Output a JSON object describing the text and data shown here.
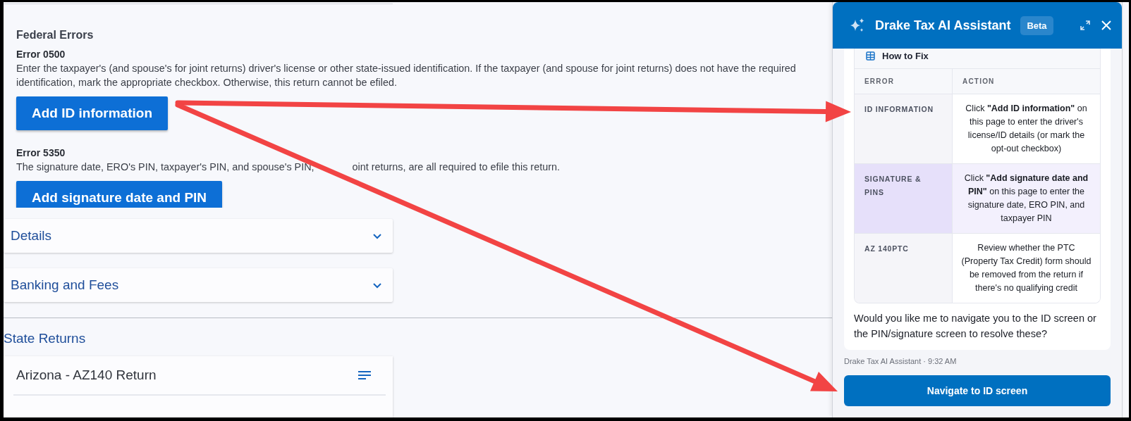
{
  "federal_errors": {
    "heading": "Federal Errors",
    "errors": [
      {
        "code": "Error 0500",
        "message_lines": [
          "Enter the taxpayer's (and spouse's for joint returns) driver's license or other state-issued identification. If the taxpayer (and spouse for joint returns) does not have the required",
          "identification, mark the appropriate checkbox. Otherwise, this return cannot be efiled."
        ],
        "button": "Add ID information"
      },
      {
        "code": "Error 5350",
        "message_parts": [
          "The signature date, ERO's PIN, taxpayer's PIN, and spouse's PIN,",
          "oint returns, are all required to efile this return."
        ],
        "button": "Add signature date and PIN"
      }
    ]
  },
  "sections": [
    {
      "label": "Details",
      "expanded": false
    },
    {
      "label": "Banking and Fees",
      "expanded": false
    }
  ],
  "state_returns": {
    "heading": "State Returns",
    "returns": [
      {
        "title": "Arizona - AZ140 Return"
      }
    ]
  },
  "assistant": {
    "title": "Drake Tax AI Assistant",
    "badge": "Beta",
    "table_title": "How to Fix",
    "columns": [
      "ERROR",
      "ACTION"
    ],
    "rows": [
      {
        "error": "ID INFORMATION",
        "action": "Click **\"Add ID information\"** on this page to enter the driver's license/ID details (or mark the opt-out checkbox)",
        "highlighted": false
      },
      {
        "error": "SIGNATURE & PINS",
        "action": "Click **\"Add signature date and PIN\"** on this page to enter the signature date, ERO PIN, and taxpayer PIN",
        "highlighted": true
      },
      {
        "error": "AZ 140PTC",
        "action": "Review whether the PTC (Property Tax Credit) form should be removed from the return if there's no qualifying credit",
        "highlighted": false
      }
    ],
    "message": "Would you like me to navigate you to the ID screen or the PIN/signature screen to resolve these?",
    "meta": "Drake Tax AI Assistant · 9:32 AM",
    "action_button": "Navigate to ID screen"
  },
  "annotations": [
    {
      "kind": "arrow"
    },
    {
      "kind": "arrow"
    }
  ]
}
